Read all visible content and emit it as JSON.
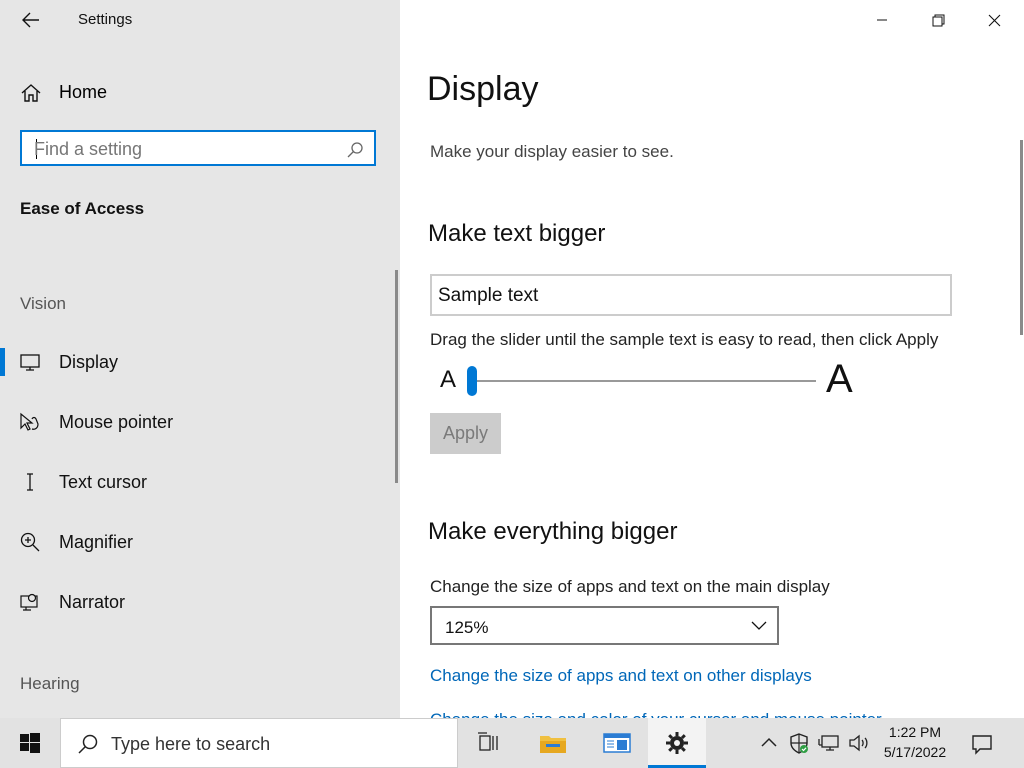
{
  "window": {
    "title": "Settings"
  },
  "sidebar": {
    "home_label": "Home",
    "search_placeholder": "Find a setting",
    "group_title": "Ease of Access",
    "sections": {
      "vision": "Vision",
      "hearing": "Hearing"
    },
    "items": [
      {
        "label": "Display",
        "icon": "monitor-icon",
        "selected": true
      },
      {
        "label": "Mouse pointer",
        "icon": "mouse-pointer-icon"
      },
      {
        "label": "Text cursor",
        "icon": "text-cursor-icon"
      },
      {
        "label": "Magnifier",
        "icon": "magnifier-icon"
      },
      {
        "label": "Narrator",
        "icon": "narrator-icon"
      }
    ]
  },
  "main": {
    "title": "Display",
    "subtitle": "Make your display easier to see.",
    "text_bigger": {
      "heading": "Make text bigger",
      "sample": "Sample text",
      "instruction": "Drag the slider until the sample text is easy to read, then click Apply",
      "small_a": "A",
      "big_a": "A",
      "slider_value_percent": 0,
      "apply_label": "Apply"
    },
    "everything_bigger": {
      "heading": "Make everything bigger",
      "label": "Change the size of apps and text on the main display",
      "scale_value": "125%",
      "link_other_displays": "Change the size of apps and text on other displays",
      "link_cut": "Change the size and color of your cursor and mouse pointer"
    }
  },
  "taskbar": {
    "search_placeholder": "Type here to search",
    "time": "1:22 PM",
    "date": "5/17/2022"
  },
  "colors": {
    "accent": "#0078d4",
    "link": "#0067b8",
    "sidebar_bg": "#e6e6e6"
  }
}
